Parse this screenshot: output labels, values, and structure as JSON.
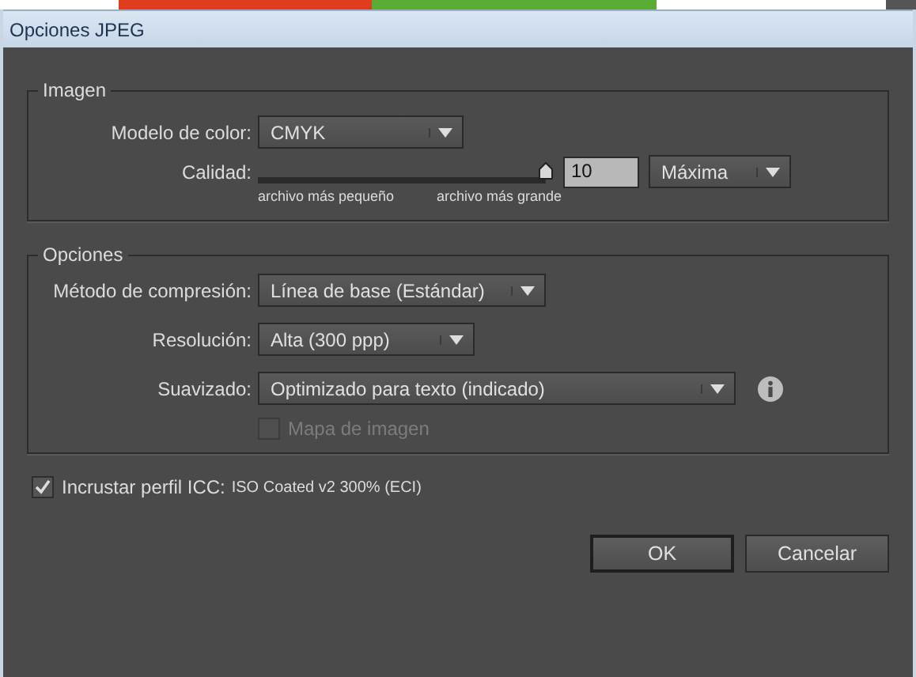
{
  "window": {
    "title": "Opciones JPEG"
  },
  "imagen": {
    "legend": "Imagen",
    "color_model": {
      "label": "Modelo de color:",
      "value": "CMYK"
    },
    "quality": {
      "label": "Calidad:",
      "level": 1,
      "value": "10",
      "preset": "Máxima",
      "min_caption": "archivo más pequeño",
      "max_caption": "archivo más grande"
    }
  },
  "opciones": {
    "legend": "Opciones",
    "selects": [
      {
        "label": "Método de compresión:",
        "value": "Línea de base (Estándar)",
        "info": false
      },
      {
        "label": "Resolución:",
        "value": "Alta (300 ppp)",
        "info": false
      },
      {
        "label": "Suavizado:",
        "value": "Optimizado para texto (indicado)",
        "info": true
      }
    ],
    "image_map": {
      "label": "Mapa de imagen",
      "checked": false,
      "disabled": true
    }
  },
  "embed_icc": {
    "label": "Incrustar perfil ICC:",
    "profile": "ISO Coated v2 300% (ECI)",
    "checked": true,
    "disabled": false
  },
  "buttons": [
    {
      "label": "OK",
      "default": true
    },
    {
      "label": "Cancelar",
      "default": false
    }
  ]
}
